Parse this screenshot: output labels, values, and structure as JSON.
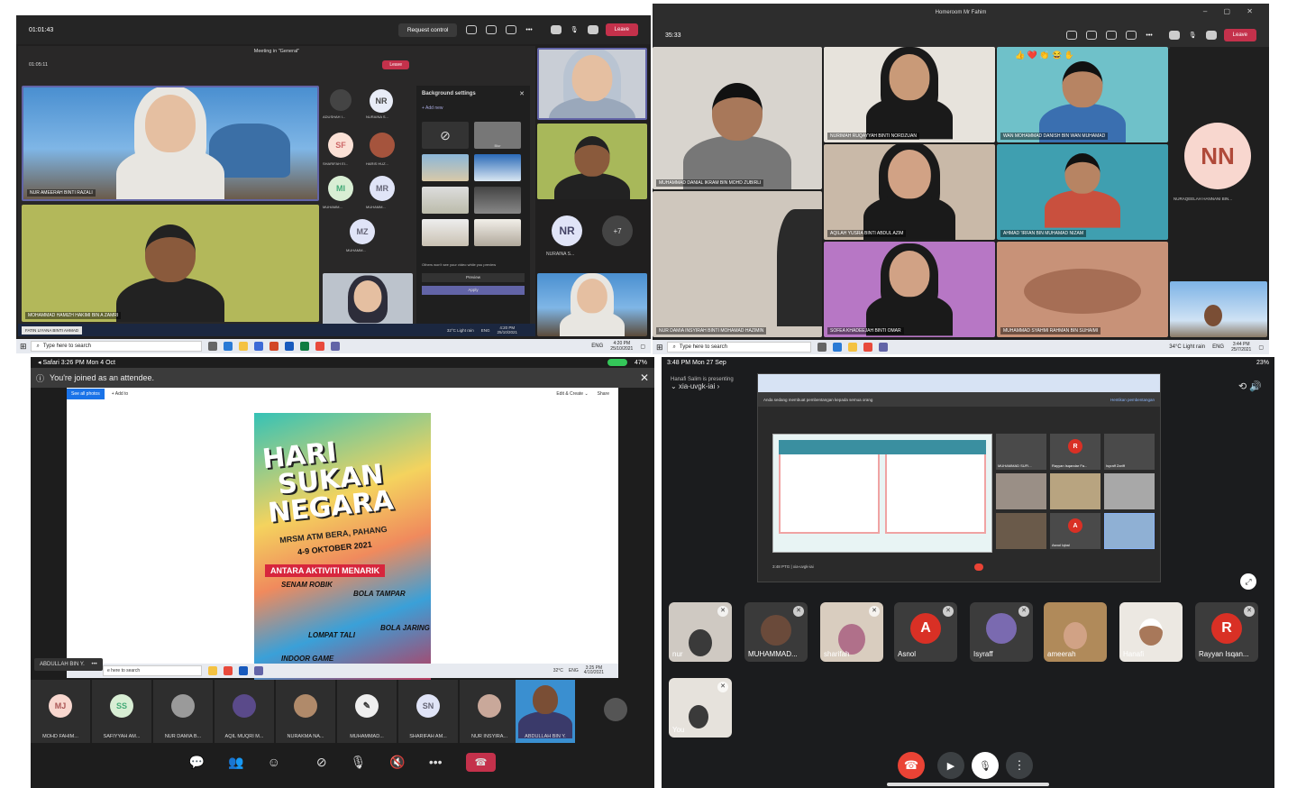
{
  "teams_window_1": {
    "outer_call_time": "01:01:43",
    "request_control_label": "Request control",
    "leave_label": "Leave",
    "meeting_title": "Meeting in \"General\"",
    "inner_call_time": "01:05:11",
    "inner_leave_label": "Leave",
    "participants": [
      {
        "name": "NUR AMEERAH BINTI RAZALI"
      },
      {
        "name": "MOHAMMAD HAMIZH HAKIMI BIN A ZAMRI"
      }
    ],
    "side_list": [
      {
        "initials": "",
        "name": "ADUSHAH I..."
      },
      {
        "initials": "NR",
        "name": "NURAINA S..."
      },
      {
        "initials": "SF",
        "name": "SHARIFAH EI..."
      },
      {
        "initials": "",
        "name": "HARIS HUZ..."
      },
      {
        "initials": "MI",
        "name": "MUHAMM..."
      },
      {
        "initials": "MR",
        "name": "MUHAMM..."
      },
      {
        "initials": "MZ",
        "name": "MUHAMM..."
      }
    ],
    "background_settings": {
      "title": "Background settings",
      "add_new": "+  Add new",
      "blur_label": "Blur",
      "note": "Others won't see your video while you preview",
      "preview_label": "Preview",
      "apply_label": "Apply"
    },
    "right_column": {
      "initials": "NR",
      "name": "NURAINA S...",
      "more": "+7"
    },
    "bottom_banner": "FATIN LIYANA BINTI AHMAD",
    "inner_taskbar": {
      "weather": "32°C  Light rain",
      "lang": "ENG",
      "time": "4:20 PM",
      "date": "25/10/2021"
    },
    "taskbar": {
      "search_placeholder": "Type here to search",
      "weather": "",
      "lang": "ENG",
      "time": "4:20 PM",
      "date": "25/10/2021"
    }
  },
  "teams_window_2": {
    "window_title": "Homeroom Mr Fahim",
    "call_time": "35:33",
    "leave_label": "Leave",
    "reactions": "👍 ❤️ 👏 😂 ✋",
    "tiles": [
      {
        "name": "MUHAMMAD DANIAL IKRAM BIN MOHD ZUBIRLI"
      },
      {
        "name": "NURIMAH RUQAYYAH BINTI NORDZUAN"
      },
      {
        "name": "WAN MOHAMMAD DANISH BIN WAN MUHAMAD"
      },
      {
        "name": "AQILAH YUSRA BINTI ABDUL AZIM"
      },
      {
        "name": "AHMAD 'IRFAN BIN MUHAMAD NIZAM"
      },
      {
        "name": "NUR DAMIA INSYIRAH BINTI MOHAMAD HAZIMIN"
      },
      {
        "name": "SOFEA KHADEEJAH BINTI OMAR"
      },
      {
        "name": "MUHAMMAD SYAHMI RAHMAN BIN SUHAIMI"
      }
    ],
    "avatar": {
      "initials": "NN",
      "name": "NURAQEELAH HANNANI BIN..."
    },
    "taskbar": {
      "search_placeholder": "Type here to search",
      "weather": "34°C  Light rain",
      "lang": "ENG",
      "time": "3:44 PM",
      "date": "25/7/2021"
    }
  },
  "ipad_teams": {
    "status_left": "◂ Safari   3:26 PM   Mon 4 Oct",
    "battery": "47%",
    "banner": "You're joined as an attendee.",
    "photos_toolbar": {
      "see_all": "See all photos",
      "add_to": "+  Add to",
      "edit_create": "Edit & Create ⌄",
      "share": "Share"
    },
    "poster": {
      "line1": "HARI",
      "line2": "SUKAN",
      "line3": "NEGARA",
      "school": "MRSM ATM BERA, PAHANG",
      "dates": "4-9 OKTOBER 2021",
      "subtitle": "ANTARA AKTIVITI MENARIK",
      "activities": [
        "SENAM ROBIK",
        "BOLA TAMPAR",
        "LOMPAT TALI",
        "BOLA JARING",
        "INDOOR GAME"
      ]
    },
    "sharer": "ABDULLAH BIN Y.",
    "embedded_taskbar": {
      "search": "e here to search",
      "weather": "32°C",
      "lang": "ENG",
      "time": "3:25 PM",
      "date": "4/10/2021"
    },
    "strip": [
      {
        "initials": "MJ",
        "name": "MOHD FAHIM..."
      },
      {
        "initials": "SS",
        "name": "SAFIYYAH AM..."
      },
      {
        "initials": "",
        "name": "NUR DAMIA B..."
      },
      {
        "initials": "",
        "name": "AQIL MUQRI M..."
      },
      {
        "initials": "",
        "name": "NURAKMA NA..."
      },
      {
        "initials": "",
        "name": "MUHAMMAD..."
      },
      {
        "initials": "SN",
        "name": "SHARIFAH AM..."
      },
      {
        "initials": "",
        "name": "NUR INSYIRA..."
      },
      {
        "initials": "",
        "name": "ABDULLAH BIN Y."
      }
    ]
  },
  "ipad_meet": {
    "status_left": "3:48 PM   Mon 27 Sep",
    "battery": "23%",
    "presenter": "Hanafi Salim is presenting",
    "meeting_code": "xia-uvgk-iai",
    "share_notice": "Anda sedang membuat pembentangan kepada semua orang",
    "stop_presenting": "Hentikan pembentangan",
    "inner_time": "3:48 PTG  |  xia-uvgk-iai",
    "inner_tiles": [
      {
        "name": "MUHAMMAD SUFI..."
      },
      {
        "name": "Rayyan Isqandar Fa..."
      },
      {
        "name": "Isyraff Zariff"
      },
      {
        "name": "Asnol Iqbal"
      }
    ],
    "participants": [
      {
        "initials": "",
        "name": "nur"
      },
      {
        "initials": "",
        "name": "MUHAMMAD..."
      },
      {
        "initials": "",
        "name": "sharifah"
      },
      {
        "initials": "A",
        "name": "Asnol"
      },
      {
        "initials": "",
        "name": "Isyraff"
      },
      {
        "initials": "",
        "name": "ameerah"
      },
      {
        "initials": "",
        "name": "Hanafi"
      },
      {
        "initials": "R",
        "name": "Rayyan Isqan..."
      }
    ],
    "self": {
      "name": "You"
    }
  },
  "colors": {
    "teams_leave": "#c4314b",
    "teams_dark": "#2b2b2b",
    "meet_end": "#ea4335",
    "avatar_pink": "#f8d7cf",
    "meet_avatar": "#d93025"
  }
}
